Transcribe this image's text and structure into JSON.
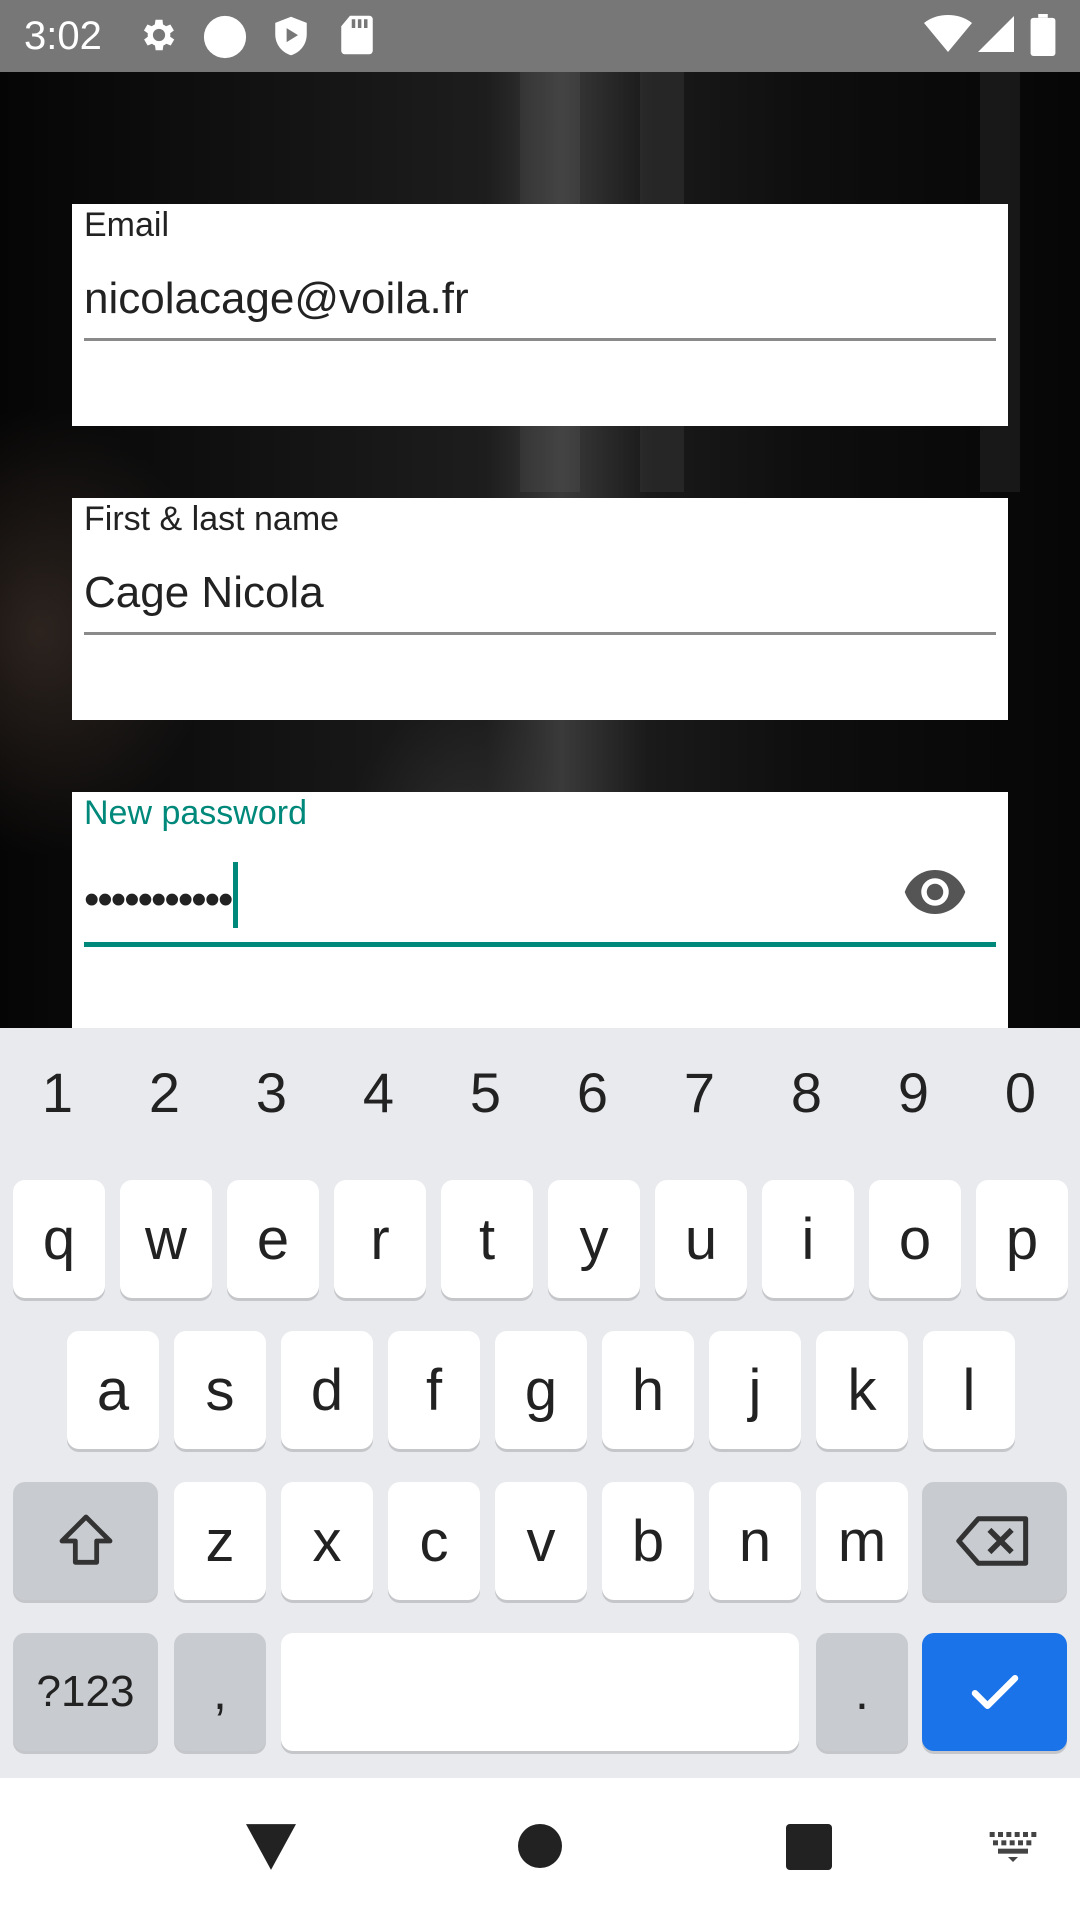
{
  "status_bar": {
    "time": "3:02",
    "icons_left": [
      "gear-icon",
      "circle-icon",
      "shield-play-icon",
      "sd-card-icon"
    ],
    "icons_right": [
      "wifi-icon",
      "signal-icon",
      "battery-icon"
    ],
    "background_color": "#777777"
  },
  "form": {
    "email": {
      "label": "Email",
      "value": "nicolacage@voila.fr"
    },
    "name": {
      "label": "First & last name",
      "value": "Cage Nicola"
    },
    "password": {
      "label": "New password",
      "value": "•••••••••••",
      "accent_color": "#00897b",
      "toggle_icon": "eye-icon"
    }
  },
  "keyboard": {
    "numbers": [
      "1",
      "2",
      "3",
      "4",
      "5",
      "6",
      "7",
      "8",
      "9",
      "0"
    ],
    "row1": [
      "q",
      "w",
      "e",
      "r",
      "t",
      "y",
      "u",
      "i",
      "o",
      "p"
    ],
    "row2": [
      "a",
      "s",
      "d",
      "f",
      "g",
      "h",
      "j",
      "k",
      "l"
    ],
    "row3": [
      "z",
      "x",
      "c",
      "v",
      "b",
      "n",
      "m"
    ],
    "symbols_label": "?123",
    "comma": ",",
    "period": ".",
    "shift_icon": "shift-icon",
    "backspace_icon": "backspace-icon",
    "enter_icon": "check-icon",
    "enter_color": "#1a73e8"
  },
  "nav_bar": {
    "icons": [
      "back-triangle-icon",
      "home-circle-icon",
      "recents-square-icon",
      "keyboard-switch-icon"
    ]
  }
}
